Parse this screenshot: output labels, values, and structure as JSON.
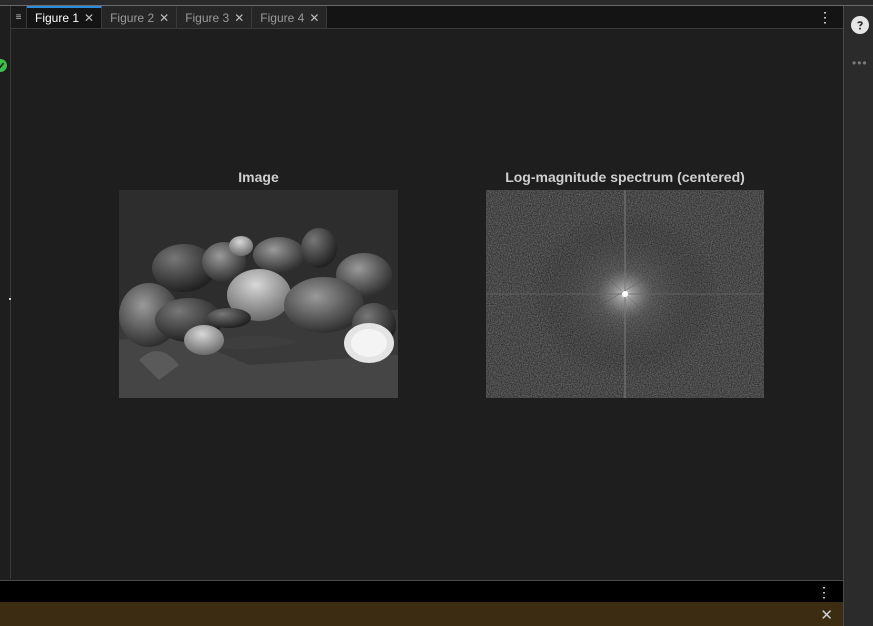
{
  "tabs": [
    {
      "label": "Figure 1",
      "active": true
    },
    {
      "label": "Figure 2",
      "active": false
    },
    {
      "label": "Figure 3",
      "active": false
    },
    {
      "label": "Figure 4",
      "active": false
    }
  ],
  "figure": {
    "left_title": "Image",
    "right_title": "Log-magnitude spectrum (centered)"
  },
  "icons": {
    "tab_menu": "menu-lines-icon",
    "tab_close": "close-icon",
    "kebab": "vertical-dots-icon",
    "status": "check-circle-icon",
    "help": "help-icon",
    "more": "horizontal-dots-icon"
  },
  "colors": {
    "accent": "#2a8ee0",
    "status_ok": "#3fbf4a",
    "background": "#1e1e1e",
    "bottom_bar": "#3b2c12"
  }
}
